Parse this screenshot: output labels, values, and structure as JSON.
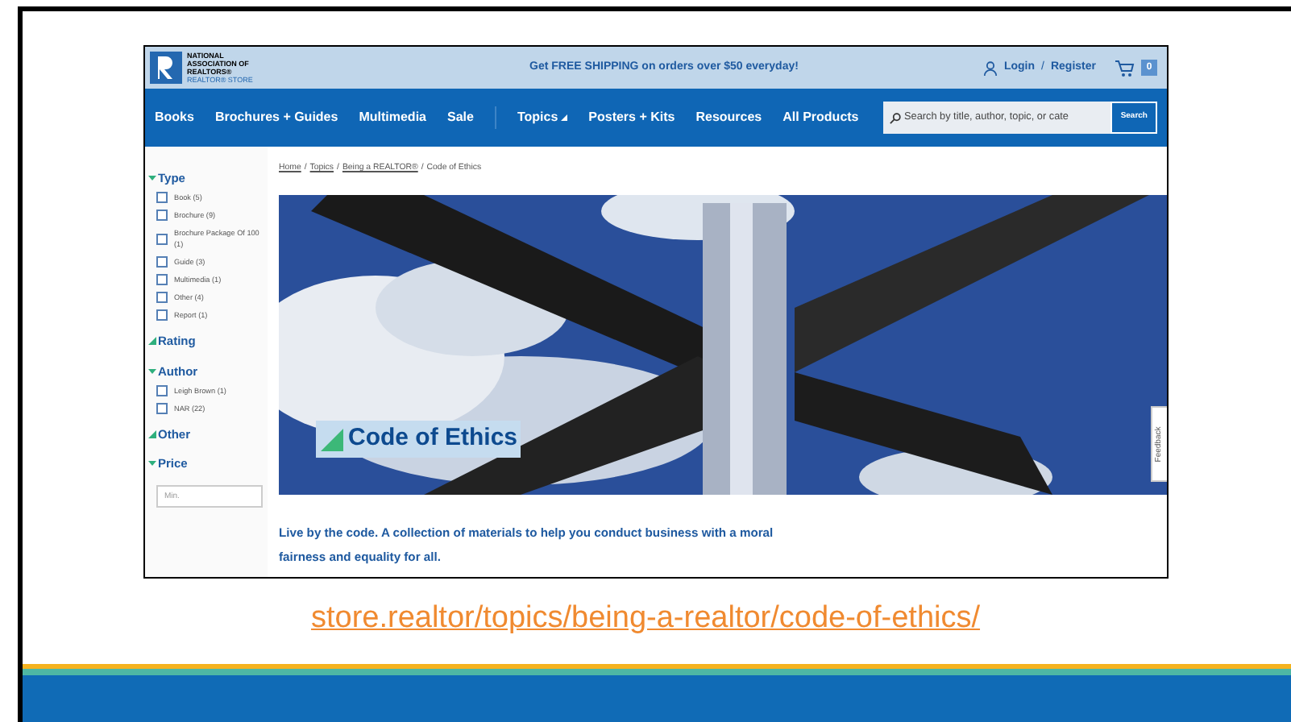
{
  "top_bar": {
    "logo_lines": [
      "NATIONAL",
      "ASSOCIATION OF",
      "REALTORS®"
    ],
    "logo_sub": "REALTOR® STORE",
    "promo": "Get FREE SHIPPING on orders over $50 everyday!",
    "login": "Login",
    "separator": "/",
    "register": "Register",
    "cart_count": "0"
  },
  "nav": {
    "items": [
      {
        "label": "Books",
        "dropdown": false
      },
      {
        "label": "Brochures + Guides",
        "dropdown": false
      },
      {
        "label": "Multimedia",
        "dropdown": false
      },
      {
        "label": "Sale",
        "dropdown": false
      },
      {
        "label": "Topics",
        "dropdown": true
      },
      {
        "label": "Posters + Kits",
        "dropdown": false
      },
      {
        "label": "Resources",
        "dropdown": false
      },
      {
        "label": "All Products",
        "dropdown": false
      }
    ],
    "search": {
      "placeholder": "Search by title, author, topic, or cate",
      "button": "Search"
    }
  },
  "sidebar": {
    "sections": [
      {
        "title": "Type",
        "expanded": true,
        "options": [
          {
            "label": "Book (5)",
            "checked": false
          },
          {
            "label": "Brochure (9)",
            "checked": false
          },
          {
            "label": "Brochure Package Of 100 (1)",
            "checked": false
          },
          {
            "label": "Guide (3)",
            "checked": false
          },
          {
            "label": "Multimedia (1)",
            "checked": false
          },
          {
            "label": "Other (4)",
            "checked": false
          },
          {
            "label": "Report (1)",
            "checked": false
          }
        ]
      },
      {
        "title": "Rating",
        "expanded": false
      },
      {
        "title": "Author",
        "expanded": true,
        "options": [
          {
            "label": "Leigh Brown (1)",
            "checked": false
          },
          {
            "label": "NAR (22)",
            "checked": false
          }
        ]
      },
      {
        "title": "Other",
        "expanded": false
      },
      {
        "title": "Price",
        "expanded": true,
        "min_placeholder": "Min."
      }
    ]
  },
  "breadcrumb": [
    {
      "kind": "link",
      "label": "Home"
    },
    {
      "kind": "separator",
      "label": "/"
    },
    {
      "kind": "link",
      "label": "Topics"
    },
    {
      "kind": "separator",
      "label": "/"
    },
    {
      "kind": "link",
      "label": "Being a REALTOR®"
    },
    {
      "kind": "separator",
      "label": "/"
    },
    {
      "kind": "current",
      "label": "Code of Ethics"
    }
  ],
  "hero": {
    "kind": "picture",
    "title": "Code of Ethics"
  },
  "feedback": "Feedback",
  "description": [
    "Live by the code. A collection of materials to help you conduct business with a moral",
    "fairness and equality for all."
  ],
  "slide_link": "store.realtor/topics/being-a-realtor/code-of-ethics/"
}
